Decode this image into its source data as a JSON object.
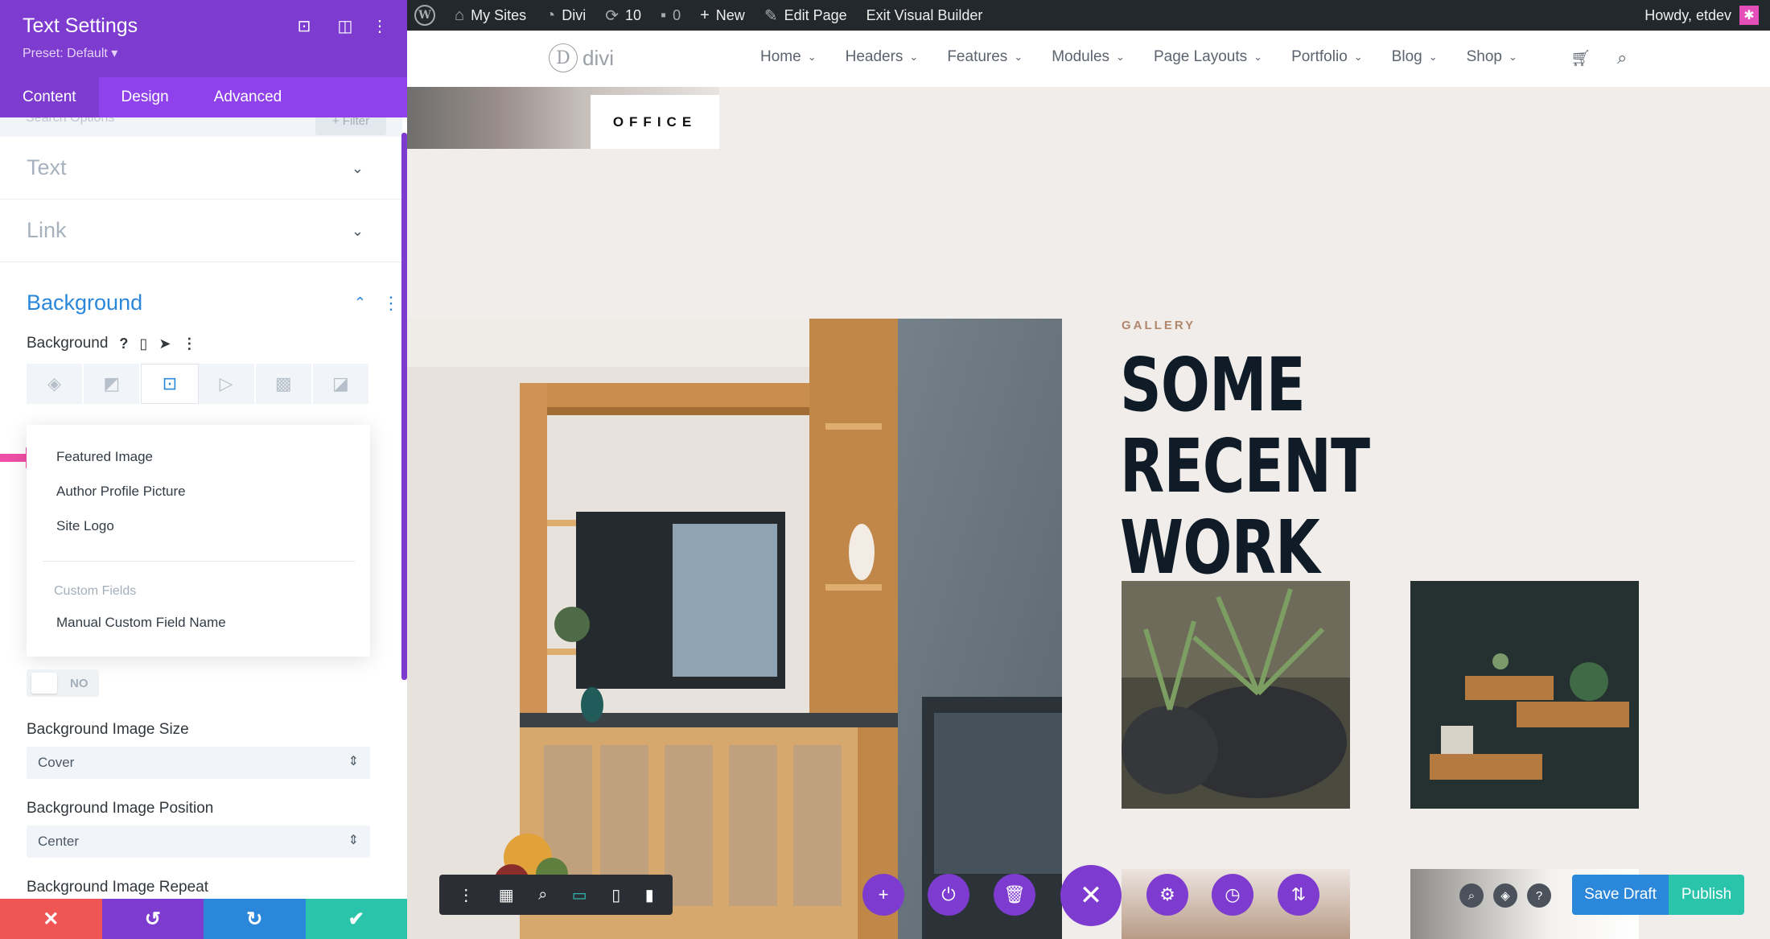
{
  "admin_bar": {
    "my_sites": "My Sites",
    "site_name": "Divi",
    "updates_count": "10",
    "comments_count": "0",
    "new_label": "New",
    "edit_page": "Edit Page",
    "exit_builder": "Exit Visual Builder",
    "howdy": "Howdy, etdev"
  },
  "panel": {
    "title": "Text Settings",
    "preset": "Preset: Default ▾",
    "tabs": [
      "Content",
      "Design",
      "Advanced"
    ],
    "active_tab": "Content",
    "search_placeholder": "Search Options",
    "filter_label": "+ Filter",
    "sections": {
      "text": "Text",
      "link": "Link",
      "background": "Background"
    },
    "background_field_label": "Background",
    "dynamic_menu": {
      "items": [
        "Featured Image",
        "Author Profile Picture",
        "Site Logo"
      ],
      "group_label": "Custom Fields",
      "custom_item": "Manual Custom Field Name",
      "highlighted": "Featured Image"
    },
    "toggle_value": "NO",
    "fields": {
      "size_label": "Background Image Size",
      "size_value": "Cover",
      "position_label": "Background Image Position",
      "position_value": "Center",
      "repeat_label": "Background Image Repeat"
    },
    "footer_colors": {
      "cancel": "#ef5555",
      "undo": "#7e3bd0",
      "redo": "#2b87da",
      "save": "#29c4a9"
    }
  },
  "site": {
    "logo_text": "divi",
    "nav": [
      "Home",
      "Headers",
      "Features",
      "Modules",
      "Page Layouts",
      "Portfolio",
      "Blog",
      "Shop"
    ],
    "office_label": "OFFICE",
    "gallery_label": "GALLERY",
    "heading": "SOME RECENT WORK"
  },
  "builder": {
    "save_draft": "Save Draft",
    "publish": "Publish"
  },
  "colors": {
    "divi_purple": "#7e3bd0",
    "divi_blue": "#2b87da",
    "divi_teal": "#29c4a9",
    "admin_bar": "#23282d",
    "page_bg": "#f1edea"
  }
}
